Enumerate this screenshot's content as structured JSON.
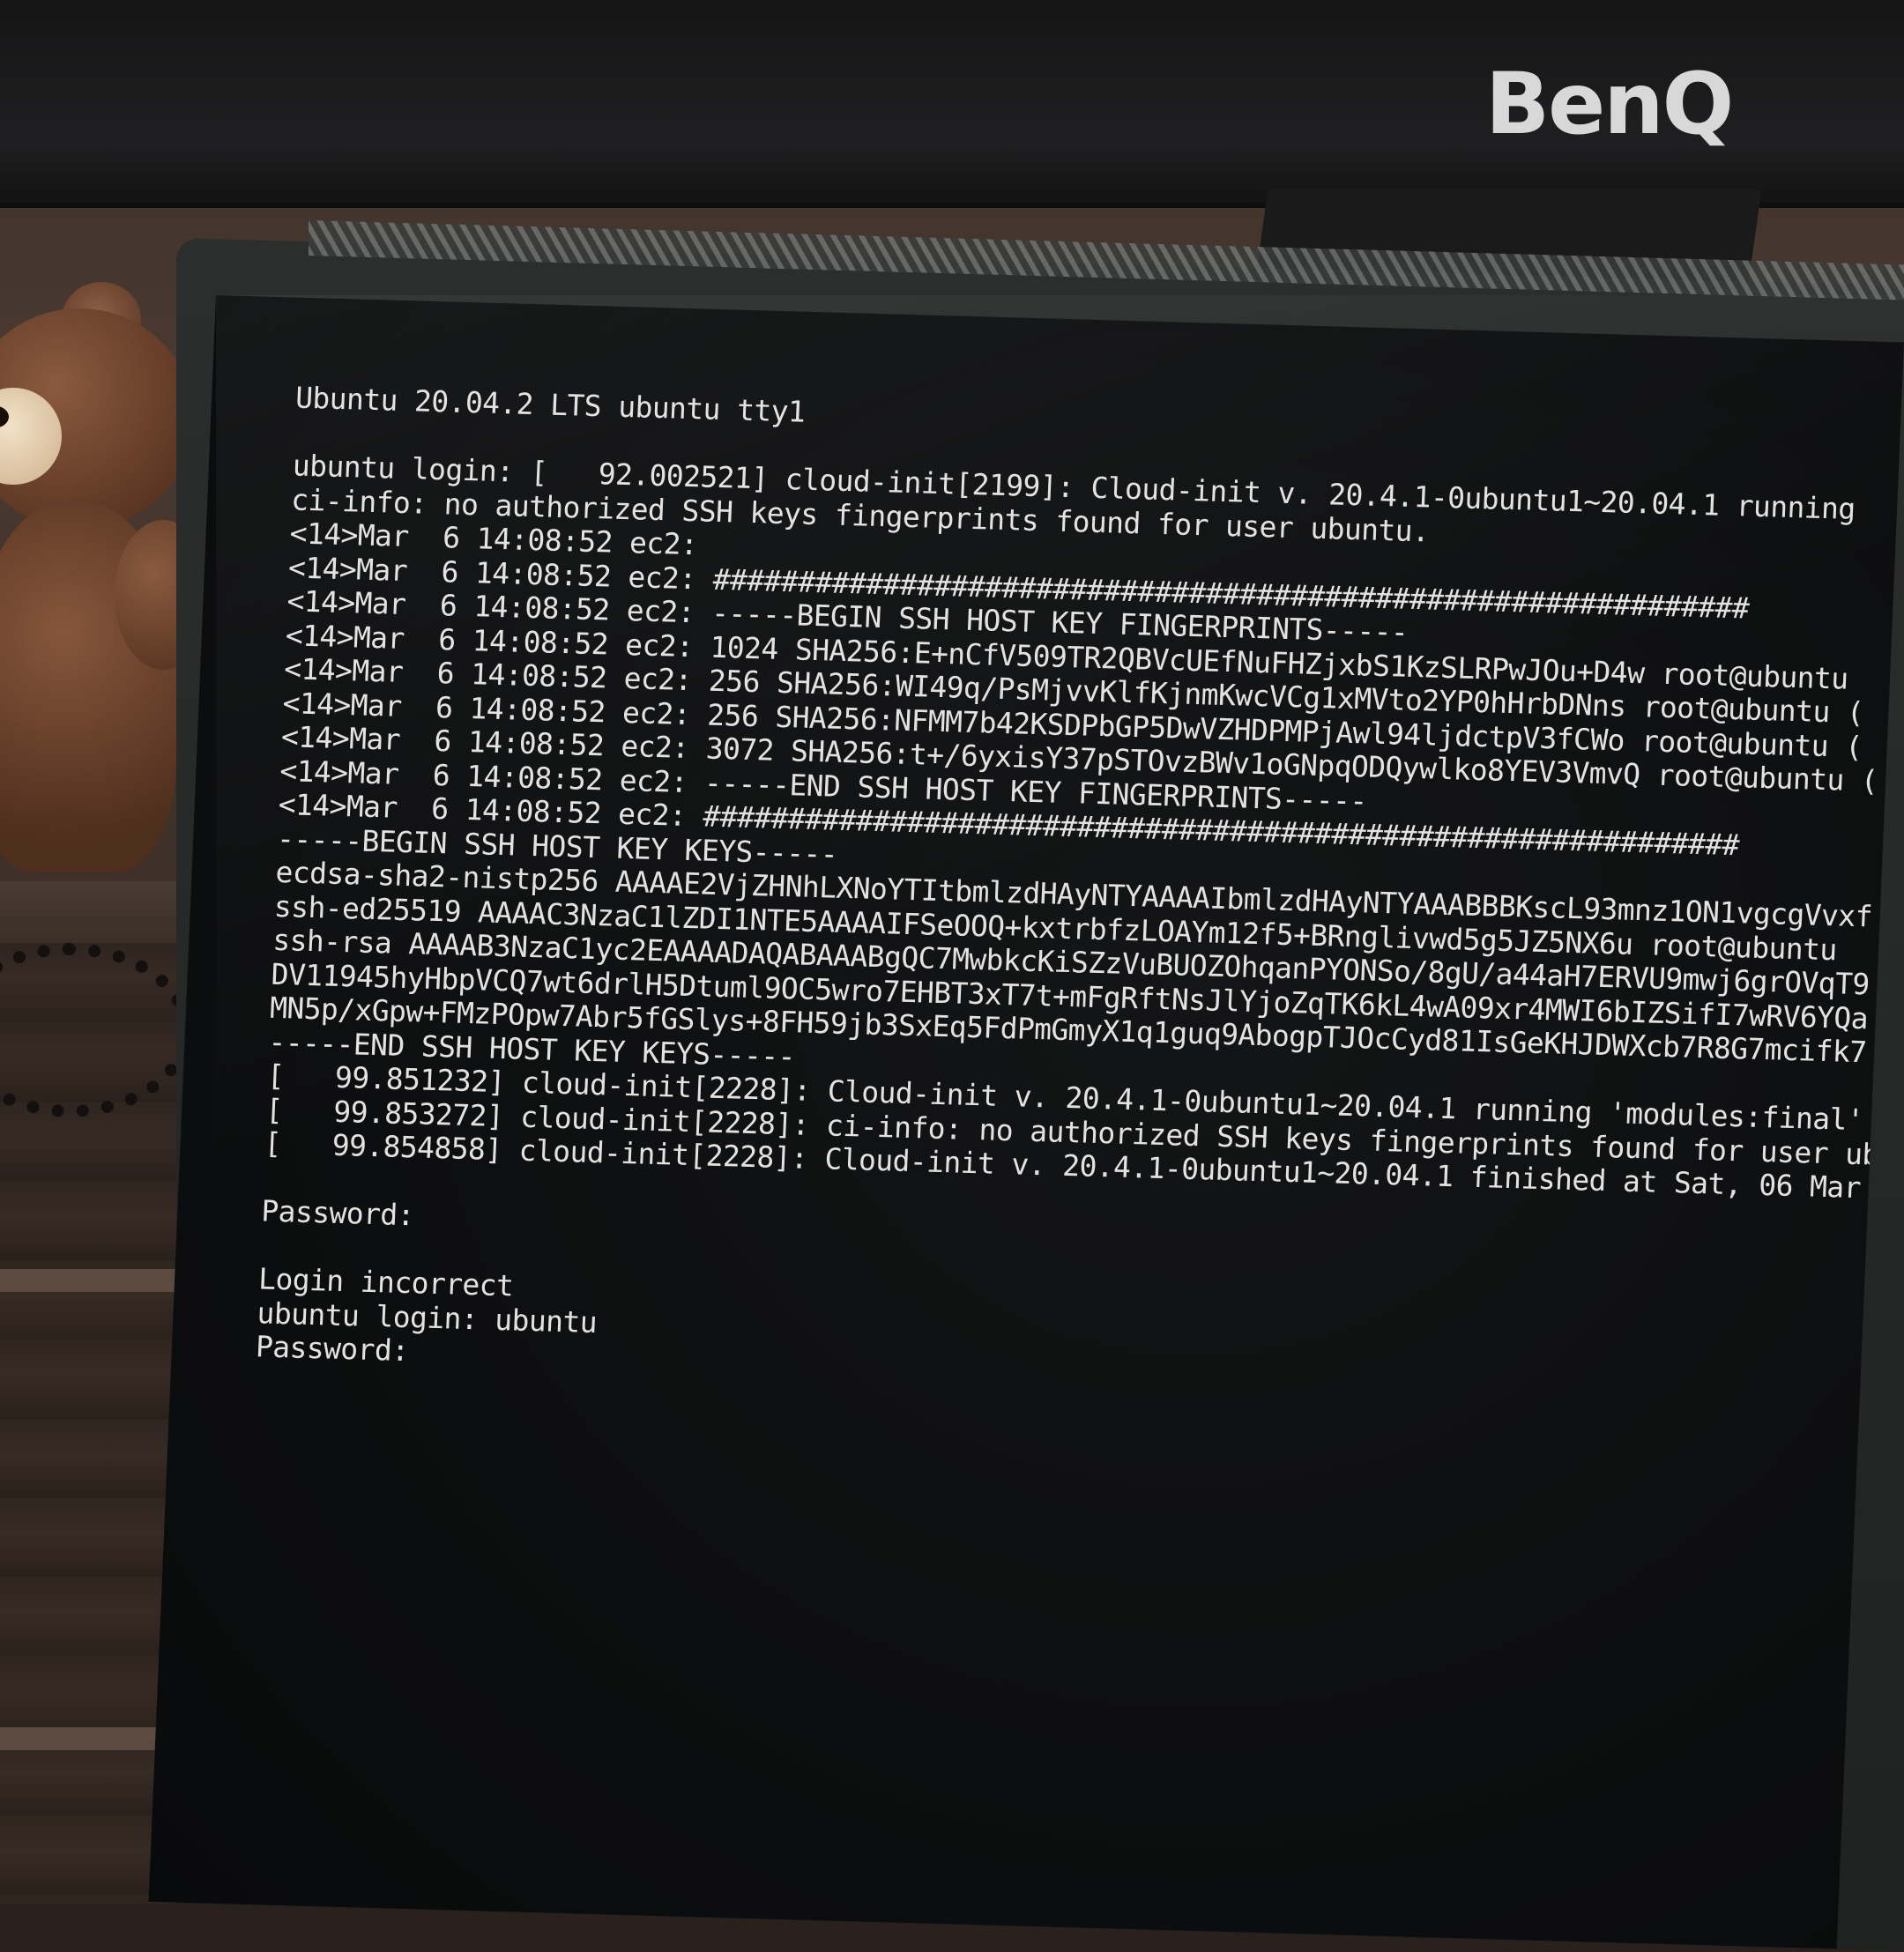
{
  "background_monitor": {
    "brand": "BenQ"
  },
  "console": {
    "lines": [
      "Ubuntu 20.04.2 LTS ubuntu tty1",
      "",
      "ubuntu login: [   92.002521] cloud-init[2199]: Cloud-init v. 20.4.1-0ubuntu1~20.04.1 running",
      "ci-info: no authorized SSH keys fingerprints found for user ubuntu.",
      "<14>Mar  6 14:08:52 ec2:",
      "<14>Mar  6 14:08:52 ec2: #############################################################",
      "<14>Mar  6 14:08:52 ec2: -----BEGIN SSH HOST KEY FINGERPRINTS-----",
      "<14>Mar  6 14:08:52 ec2: 1024 SHA256:E+nCfV509TR2QBVcUEfNuFHZjxbS1KzSLRPwJOu+D4w root@ubuntu",
      "<14>Mar  6 14:08:52 ec2: 256 SHA256:WI49q/PsMjvvKlfKjnmKwcVCg1xMVto2YP0hHrbDNns root@ubuntu (",
      "<14>Mar  6 14:08:52 ec2: 256 SHA256:NFMM7b42KSDPbGP5DwVZHDPMPjAwl94ljdctpV3fCWo root@ubuntu (",
      "<14>Mar  6 14:08:52 ec2: 3072 SHA256:t+/6yxisY37pSTOvzBWv1oGNpqODQywlko8YEV3VmvQ root@ubuntu (",
      "<14>Mar  6 14:08:52 ec2: -----END SSH HOST KEY FINGERPRINTS-----",
      "<14>Mar  6 14:08:52 ec2: #############################################################",
      "-----BEGIN SSH HOST KEY KEYS-----",
      "ecdsa-sha2-nistp256 AAAAE2VjZHNhLXNoYTItbmlzdHAyNTYAAAAIbmlzdHAyNTYAAABBBKscL93mnz1ON1vgcgVvxf",
      "ssh-ed25519 AAAAC3NzaC1lZDI1NTE5AAAAIFSeOOQ+kxtrbfzLOAYm12f5+BRnglivwd5g5JZ5NX6u root@ubuntu",
      "ssh-rsa AAAAB3NzaC1yc2EAAAADAQABAAABgQC7MwbkcKiSZzVuBUOZOhqanPYONSo/8gU/a44aH7ERVU9mwj6grOVqT9",
      "DV11945hyHbpVCQ7wt6drlH5Dtuml9OC5wro7EHBT3xT7t+mFgRftNsJlYjoZqTK6kL4wA09xr4MWI6bIZSifI7wRV6YQa",
      "MN5p/xGpw+FMzPOpw7Abr5fGSlys+8FH59jb3SxEq5FdPmGmyX1q1guq9AbogpTJOcCyd81IsGeKHJDWXcb7R8G7mcifk7",
      "-----END SSH HOST KEY KEYS-----",
      "[   99.851232] cloud-init[2228]: Cloud-init v. 20.4.1-0ubuntu1~20.04.1 running 'modules:final'",
      "[   99.853272] cloud-init[2228]: ci-info: no authorized SSH keys fingerprints found for user ub",
      "[   99.854858] cloud-init[2228]: Cloud-init v. 20.4.1-0ubuntu1~20.04.1 finished at Sat, 06 Mar",
      "",
      "Password:",
      "",
      "Login incorrect",
      "ubuntu login: ubuntu",
      "Password:"
    ]
  }
}
